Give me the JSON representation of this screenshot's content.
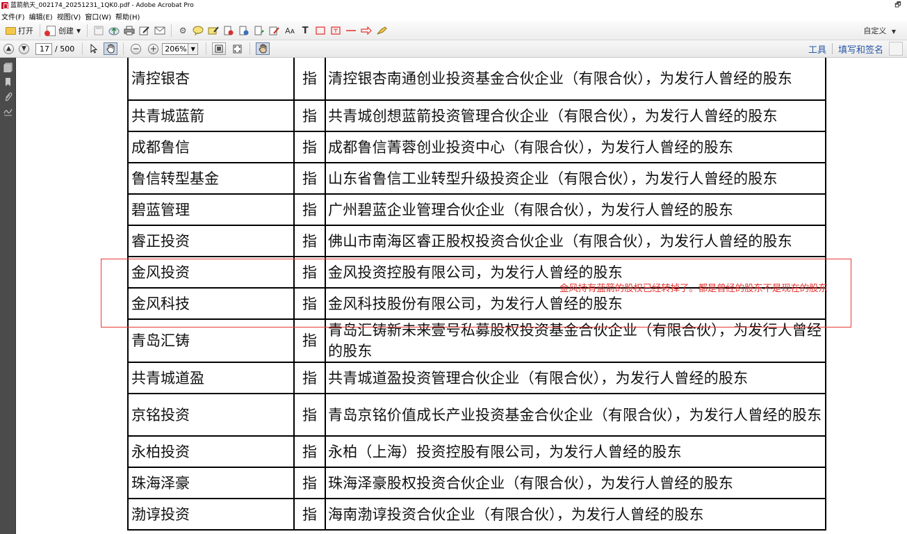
{
  "window": {
    "title": "蓝箭航天_002174_20251231_1QK0.pdf - Adobe Acrobat Pro",
    "restore_glyph": "🗗"
  },
  "menu": [
    "文件(F)",
    "编辑(E)",
    "视图(V)",
    "窗口(W)",
    "帮助(H)"
  ],
  "toolbar": {
    "open_label": "打开",
    "create_label": "创建",
    "customize_label": "自定义"
  },
  "nav": {
    "current_page": "17",
    "total_pages": "/ 500",
    "zoom": "206%"
  },
  "panels": {
    "tools_label": "工具",
    "sign_label": "填写和签名"
  },
  "table": {
    "rows": [
      {
        "abbr": "清控银杏",
        "ref": "指",
        "desc": "清控银杏南通创业投资基金合伙企业（有限合伙），为发行人曾经的股东",
        "tall": true
      },
      {
        "abbr": "共青城蓝箭",
        "ref": "指",
        "desc": "共青城创想蓝箭投资管理合伙企业（有限合伙），为发行人曾经的股东",
        "tall": false
      },
      {
        "abbr": "成都鲁信",
        "ref": "指",
        "desc": "成都鲁信菁蓉创业投资中心（有限合伙），为发行人曾经的股东",
        "tall": false
      },
      {
        "abbr": "鲁信转型基金",
        "ref": "指",
        "desc": "山东省鲁信工业转型升级投资企业（有限合伙），为发行人曾经的股东",
        "tall": false
      },
      {
        "abbr": "碧蓝管理",
        "ref": "指",
        "desc": "广州碧蓝企业管理合伙企业（有限合伙），为发行人曾经的股东",
        "tall": false
      },
      {
        "abbr": "睿正投资",
        "ref": "指",
        "desc": "佛山市南海区睿正股权投资合伙企业（有限合伙），为发行人曾经的股东",
        "tall": false
      },
      {
        "abbr": "金风投资",
        "ref": "指",
        "desc": "金风投资控股有限公司，为发行人曾经的股东",
        "tall": false
      },
      {
        "abbr": "金风科技",
        "ref": "指",
        "desc": "金风科技股份有限公司，为发行人曾经的股东",
        "tall": false
      },
      {
        "abbr": "青岛汇铸",
        "ref": "指",
        "desc": "青岛汇铸新未来壹号私募股权投资基金合伙企业（有限合伙），为发行人曾经的股东",
        "tall": true
      },
      {
        "abbr": "共青城道盈",
        "ref": "指",
        "desc": "共青城道盈投资管理合伙企业（有限合伙），为发行人曾经的股东",
        "tall": false
      },
      {
        "abbr": "京铭投资",
        "ref": "指",
        "desc": "青岛京铭价值成长产业投资基金合伙企业（有限合伙），为发行人曾经的股东",
        "tall": true
      },
      {
        "abbr": "永柏投资",
        "ref": "指",
        "desc": "永柏（上海）投资控股有限公司，为发行人曾经的股东",
        "tall": false
      },
      {
        "abbr": "珠海泽豪",
        "ref": "指",
        "desc": "珠海泽豪股权投资合伙企业（有限合伙），为发行人曾经的股东",
        "tall": false
      },
      {
        "abbr": "渤谆投资",
        "ref": "指",
        "desc": "海南渤谆投资合伙企业（有限合伙），为发行人曾经的股东",
        "tall": false
      }
    ]
  },
  "annotation": {
    "text": "金风持有蓝箭的股权已经转掉了。都是曾经的股东不是现在的股东",
    "color": "#e53935"
  },
  "icons": [
    "acrobat-icon",
    "folder-icon",
    "create-pdf-icon",
    "save-icon",
    "upload-cloud-icon",
    "print-icon",
    "edit-icon",
    "email-icon",
    "gear-icon",
    "comment-icon",
    "highlight-icon",
    "stamp-icon",
    "attach-icon",
    "sign-icon",
    "text-icon",
    "rectangle-icon",
    "line-icon",
    "arrow-icon",
    "pencil-icon",
    "page-up-icon",
    "page-down-icon",
    "select-icon",
    "hand-icon",
    "zoom-out-icon",
    "zoom-in-icon",
    "fit-page-icon",
    "full-screen-icon",
    "read-mode-icon",
    "pages-panel-icon",
    "bookmarks-icon",
    "attachments-icon",
    "signatures-icon"
  ]
}
